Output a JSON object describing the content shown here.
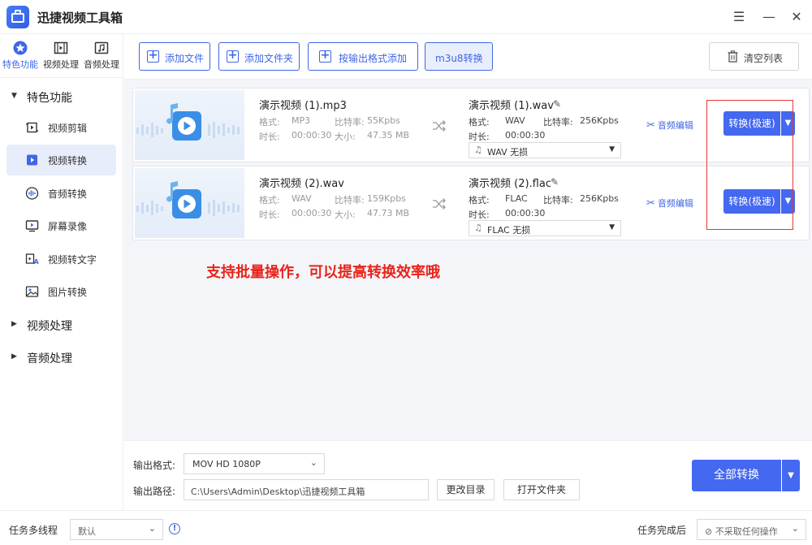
{
  "app": {
    "title": "迅捷视频工具箱"
  },
  "window_controls": {
    "menu_icon": "☰",
    "min_icon": "—",
    "close_icon": "✕"
  },
  "topnav": [
    {
      "label": "特色功能",
      "icon": "star-icon",
      "active": true
    },
    {
      "label": "视频处理",
      "icon": "film-icon",
      "active": false
    },
    {
      "label": "音频处理",
      "icon": "music-icon",
      "active": false
    }
  ],
  "sidebar": {
    "group_featured": "特色功能",
    "items": [
      {
        "label": "视频剪辑",
        "icon": "crop-icon"
      },
      {
        "label": "视频转换",
        "icon": "video-convert-icon",
        "active": true
      },
      {
        "label": "音频转换",
        "icon": "audio-wave-icon"
      },
      {
        "label": "屏幕录像",
        "icon": "screen-record-icon"
      },
      {
        "label": "视频转文字",
        "icon": "video-to-text-icon"
      },
      {
        "label": "图片转换",
        "icon": "image-icon"
      }
    ],
    "group_video": "视频处理",
    "group_audio": "音频处理"
  },
  "toolbar": {
    "add_file": "添加文件",
    "add_folder": "添加文件夹",
    "add_by_format": "按输出格式添加",
    "m3u8": "m3u8转换",
    "clear": "清空列表"
  },
  "files": [
    {
      "name": "演示视频 (1).mp3",
      "format_label": "格式:",
      "format": "MP3",
      "bitrate_label": "比特率:",
      "bitrate": "55Kpbs",
      "duration_label": "时长:",
      "duration": "00:00:30",
      "size_label": "大小:",
      "size": "47.35 MB",
      "out_name": "演示视频 (1).wav",
      "out_format_label": "格式:",
      "out_format": "WAV",
      "out_bitrate_label": "比特率:",
      "out_bitrate": "256Kpbs",
      "out_duration_label": "时长:",
      "out_duration": "00:00:30",
      "select_value": "WAV  无损",
      "audio_edit": "音频编辑",
      "convert": "转换(极速)"
    },
    {
      "name": "演示视频 (2).wav",
      "format_label": "格式:",
      "format": "WAV",
      "bitrate_label": "比特率:",
      "bitrate": "159Kpbs",
      "duration_label": "时长:",
      "duration": "00:00:30",
      "size_label": "大小:",
      "size": "47.73 MB",
      "out_name": "演示视频 (2).flac",
      "out_format_label": "格式:",
      "out_format": "FLAC",
      "out_bitrate_label": "比特率:",
      "out_bitrate": "256Kpbs",
      "out_duration_label": "时长:",
      "out_duration": "00:00:30",
      "select_value": "FLAC  无损",
      "audio_edit": "音频编辑",
      "convert": "转换(极速)"
    }
  ],
  "annotation": "支持批量操作，可以提高转换效率哦",
  "output": {
    "format_label": "输出格式:",
    "format_value": "MOV   HD 1080P",
    "path_label": "输出路径:",
    "path_value": "C:\\Users\\Admin\\Desktop\\迅捷视频工具箱",
    "change_dir": "更改目录",
    "open_folder": "打开文件夹",
    "convert_all": "全部转换"
  },
  "statusbar": {
    "multithread_label": "任务多线程",
    "multithread_value": "默认",
    "after_label": "任务完成后",
    "after_value": "不采取任何操作"
  },
  "colors": {
    "accent": "#4468ef",
    "annotation": "#e8241b",
    "highlight_box": "#e53935"
  }
}
